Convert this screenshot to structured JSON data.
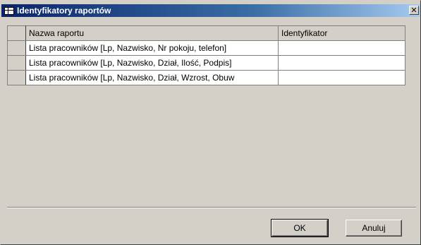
{
  "window": {
    "title": "Identyfikatory raportów",
    "close_symbol": "✕",
    "icon": "table-icon"
  },
  "grid": {
    "columns": [
      "Nazwa raportu",
      "Identyfikator"
    ],
    "rows": [
      {
        "name": "Lista pracowników [Lp, Nazwisko, Nr pokoju, telefon]",
        "id": ""
      },
      {
        "name": "Lista pracowników [Lp, Nazwisko, Dział, Ilość, Podpis]",
        "id": ""
      },
      {
        "name": "Lista pracowników [Lp, Nazwisko, Dział, Wzrost, Obuw",
        "id": ""
      }
    ]
  },
  "buttons": {
    "ok": "OK",
    "cancel": "Anuluj"
  }
}
